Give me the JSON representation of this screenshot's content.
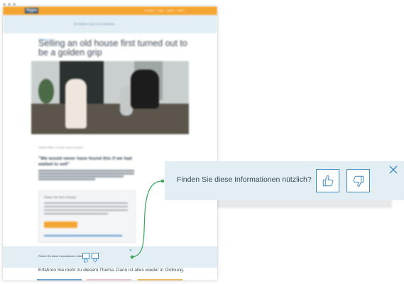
{
  "header": {
    "logo": "Hypo",
    "nav_items": [
      "Kontakt",
      "Login",
      "Suche",
      "Menü"
    ]
  },
  "banner": {
    "text": "Ihr Partner rund um Ihr Zuhause"
  },
  "article": {
    "kicker": "Wohnen",
    "title": "Selling an old house first turned out to be a golden grip",
    "caption": "Familie Müller vor ihrem neuen Zuhause",
    "subheading": "\"We would never have found this if we had waited to sell\""
  },
  "info_box": {
    "title": "Planen Sie Ihren Umzug?"
  },
  "feedback_small": {
    "question": "Finden Sie diese Informationen nützlich?"
  },
  "more": {
    "text": "Erfahren Sie mehr zu diesem Thema. Dann ist alles wieder in Ordnung."
  },
  "feedback_popup": {
    "question": "Finden Sie diese Informationen nützlich?",
    "like_icon": "thumbs-up-icon",
    "dislike_icon": "thumbs-down-icon",
    "close_icon": "close-icon"
  },
  "colors": {
    "accent_orange": "#f4a531",
    "panel_blue": "#e2eef4",
    "icon_blue": "#3d8bc0",
    "connector_green": "#3aa65a",
    "text_dark": "#3b4a57"
  }
}
